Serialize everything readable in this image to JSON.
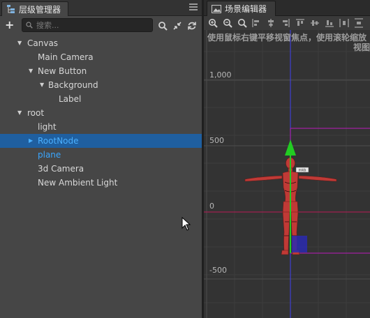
{
  "hierarchy": {
    "tab_title": "层级管理器",
    "search": {
      "placeholder": "搜索..."
    },
    "tree": [
      {
        "label": "Canvas",
        "depth": 0,
        "arrow": "down"
      },
      {
        "label": "Main Camera",
        "depth": 1,
        "arrow": "none"
      },
      {
        "label": "New Button",
        "depth": 1,
        "arrow": "down"
      },
      {
        "label": "Background",
        "depth": 2,
        "arrow": "down"
      },
      {
        "label": "Label",
        "depth": 3,
        "arrow": "none"
      },
      {
        "label": "root",
        "depth": 0,
        "arrow": "down"
      },
      {
        "label": "light",
        "depth": 1,
        "arrow": "none"
      },
      {
        "label": "RootNode",
        "depth": 1,
        "arrow": "right",
        "state": "selected"
      },
      {
        "label": "plane",
        "depth": 1,
        "arrow": "none",
        "state": "blue"
      },
      {
        "label": "3d Camera",
        "depth": 1,
        "arrow": "none"
      },
      {
        "label": "New Ambient Light",
        "depth": 1,
        "arrow": "none"
      }
    ]
  },
  "scene": {
    "tab_title": "场景编辑器",
    "hint_line1": "使用鼠标右键平移视窗焦点，使用滚轮缩放",
    "hint_line2": "视图",
    "axis_labels": [
      "1,000",
      "500",
      "0",
      "-500"
    ],
    "model_tag": "mkb"
  },
  "colors": {
    "panel_bg": "#464646",
    "selection_bg": "#1f5fa0",
    "selection_text": "#4ab0ff",
    "link_blue": "#3aa6ff",
    "y_axis": "#4040d0",
    "x_axis": "#a02050",
    "bounds": "#a020a0",
    "gizmo_green": "#22cc22",
    "model_red": "#c03a36"
  },
  "icons": {
    "hierarchy_tab": "hierarchy-icon",
    "scene_tab": "scene-icon",
    "add": "plus-icon",
    "search": "search-icon",
    "collapse": "collapse-icon",
    "refresh": "refresh-icon"
  }
}
